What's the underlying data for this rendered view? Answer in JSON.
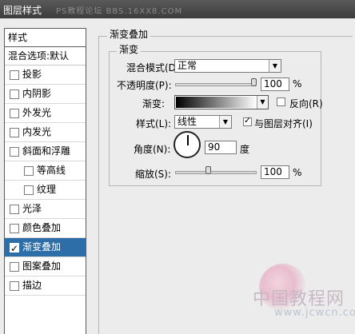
{
  "window": {
    "title": "图层样式",
    "watermark": "PS教程论坛 BBS.16XX8.COM"
  },
  "left_panel": {
    "header": "样式",
    "blend_options": "混合选项:默认",
    "items": [
      {
        "label": "投影",
        "checked": false
      },
      {
        "label": "内阴影",
        "checked": false
      },
      {
        "label": "外发光",
        "checked": false
      },
      {
        "label": "内发光",
        "checked": false
      },
      {
        "label": "斜面和浮雕",
        "checked": false
      },
      {
        "label": "等高线",
        "checked": false
      },
      {
        "label": "纹理",
        "checked": false
      },
      {
        "label": "光泽",
        "checked": false
      },
      {
        "label": "颜色叠加",
        "checked": false
      },
      {
        "label": "渐变叠加",
        "checked": true
      },
      {
        "label": "图案叠加",
        "checked": false
      },
      {
        "label": "描边",
        "checked": false
      }
    ]
  },
  "panel": {
    "group_title": "渐变叠加",
    "subgroup_title": "渐变",
    "blend_mode_label": "混合模式(D):",
    "blend_mode_value": "正常",
    "opacity_label": "不透明度(P):",
    "opacity_value": "100",
    "opacity_unit": "%",
    "opacity_level": 1.0,
    "gradient_label": "渐变:",
    "reverse_label": "反向(R)",
    "reverse_checked": false,
    "style_label": "样式(L):",
    "style_value": "线性",
    "align_label": "与图层对齐(I)",
    "align_checked": true,
    "angle_label": "角度(N):",
    "angle_value": "90",
    "angle_unit": "度",
    "scale_label": "缩放(S):",
    "scale_value": "100",
    "scale_unit": "%",
    "scale_level": 0.4
  },
  "footer_watermark": {
    "cn": "中国教程网",
    "url": "www.jcwcn.com"
  },
  "colors": {
    "selection": "#2d6ea8",
    "titlebar": "#4a4a4a",
    "background": "#ececec"
  }
}
